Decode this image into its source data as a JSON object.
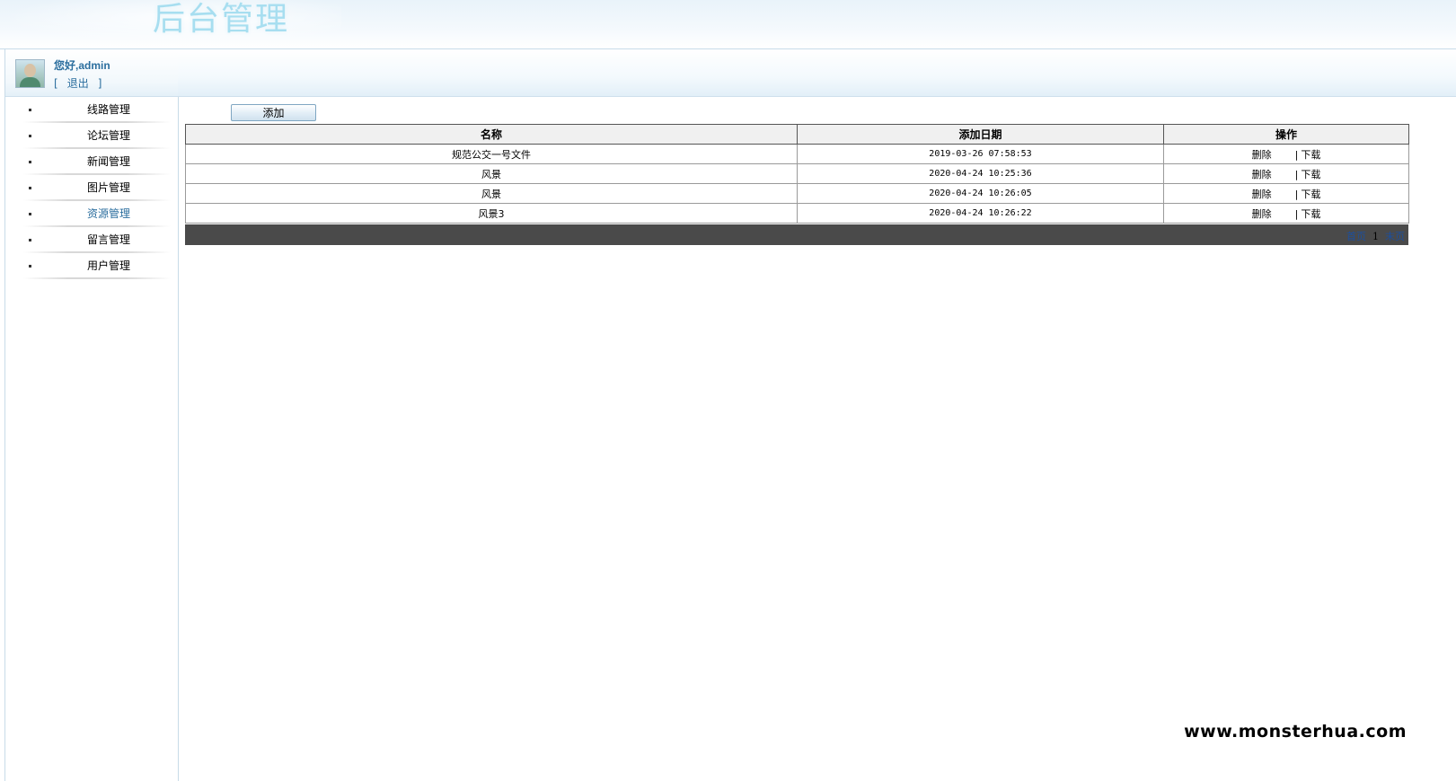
{
  "header": {
    "title": "后台管理"
  },
  "user": {
    "greeting": "您好,admin",
    "bracket_open": "[",
    "logout_label": "退出",
    "bracket_close": "]"
  },
  "sidebar": {
    "items": [
      {
        "label": "线路管理",
        "active": false
      },
      {
        "label": "论坛管理",
        "active": false
      },
      {
        "label": "新闻管理",
        "active": false
      },
      {
        "label": "图片管理",
        "active": false
      },
      {
        "label": "资源管理",
        "active": true
      },
      {
        "label": "留言管理",
        "active": false
      },
      {
        "label": "用户管理",
        "active": false
      }
    ]
  },
  "toolbar": {
    "add_label": "添加"
  },
  "table": {
    "columns": [
      "名称",
      "添加日期",
      "操作"
    ],
    "rows": [
      {
        "name": "规范公交一号文件",
        "date": "2019-03-26 07:58:53"
      },
      {
        "name": "风景",
        "date": "2020-04-24 10:25:36"
      },
      {
        "name": "风景",
        "date": "2020-04-24 10:26:05"
      },
      {
        "name": "风景3",
        "date": "2020-04-24 10:26:22"
      }
    ],
    "actions": {
      "delete": "删除",
      "separator": "|",
      "download": "下载"
    }
  },
  "pager": {
    "first": "首页",
    "current": "1",
    "last": "末页"
  },
  "watermark": "www.monsterhua.com"
}
